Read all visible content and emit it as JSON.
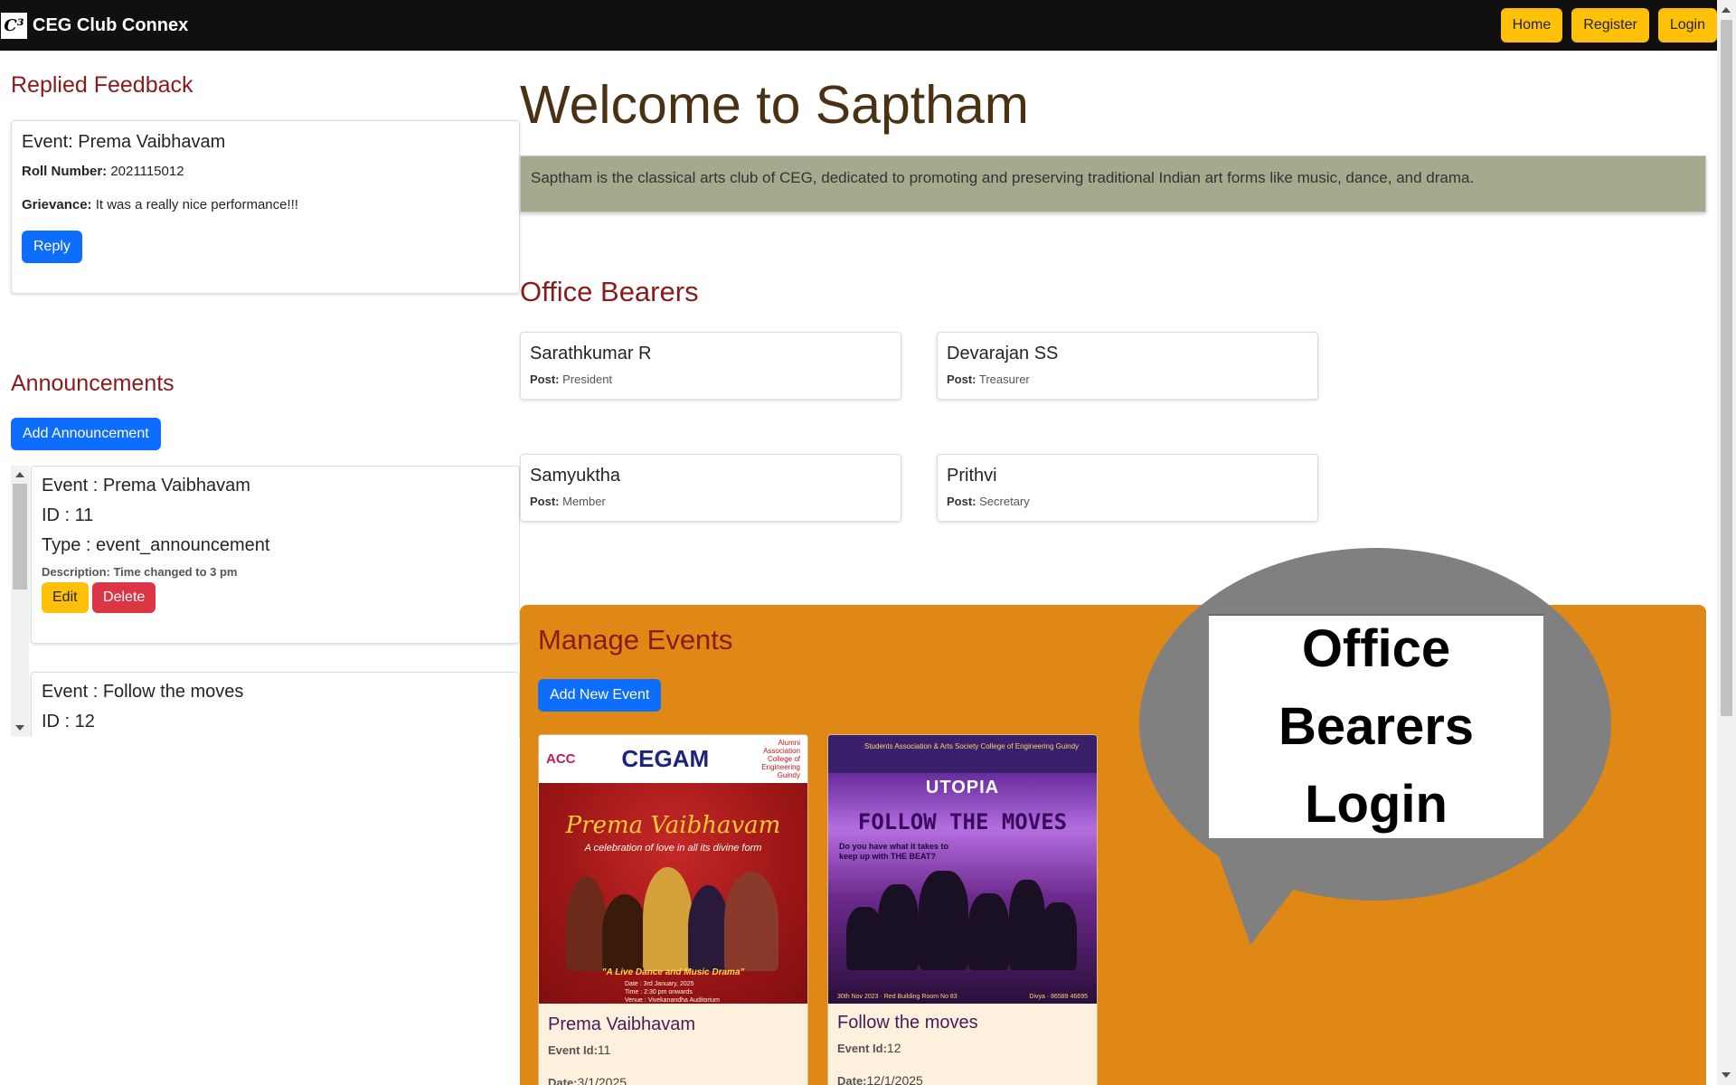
{
  "navbar": {
    "brand_logo": "C³",
    "brand": "CEG Club Connex",
    "buttons": [
      "Home",
      "Register",
      "Login"
    ]
  },
  "feedback": {
    "title": "Replied Feedback",
    "event": "Event: Prema Vaibhavam",
    "roll_label": "Roll Number:",
    "roll_value": "2021115012",
    "grievance_label": "Grievance:",
    "grievance_value": "It was a really nice performance!!!",
    "reply_label": "Reply"
  },
  "announcements": {
    "title": "Announcements",
    "add_label": "Add Announcement",
    "items": [
      {
        "event": "Event : Prema Vaibhavam",
        "id": "ID : 11",
        "type": "Type : event_announcement",
        "description": "Description: Time changed to 3 pm",
        "edit_label": "Edit",
        "delete_label": "Delete"
      },
      {
        "event": "Event : Follow the moves",
        "id": "ID : 12"
      }
    ]
  },
  "club": {
    "welcome": "Welcome to Saptham",
    "about": "Saptham is the classical arts club of CEG, dedicated to promoting and preserving traditional Indian art forms like music, dance, and drama."
  },
  "office_bearers": {
    "title": "Office Bearers",
    "post_label": "Post:",
    "members": [
      {
        "name": "Sarathkumar R",
        "post": "President"
      },
      {
        "name": "Devarajan SS",
        "post": "Treasurer"
      },
      {
        "name": "Samyuktha",
        "post": "Member"
      },
      {
        "name": "Prithvi",
        "post": "Secretary"
      }
    ]
  },
  "events": {
    "title": "Manage Events",
    "add_label": "Add New Event",
    "id_label": "Event Id:",
    "date_label": "Date:",
    "items": [
      {
        "name": "Prema Vaibhavam",
        "id": "11",
        "date": "3/1/2025",
        "poster": {
          "logo_left": "ACC",
          "logo_center": "CEGAM",
          "logo_right": "Alumni Association College of Engineering Guindy",
          "title": "Prema Vaibhavam",
          "subtitle": "A celebration of love in all its divine form",
          "tagline": "\"A Live Dance and Music Drama\"",
          "info": [
            "Date : 3rd January, 2025",
            "Time : 2:30 pm onwards",
            "Venue : Vivekanandha Auditorium"
          ]
        }
      },
      {
        "name": "Follow the moves",
        "id": "12",
        "date": "12/1/2025",
        "poster": {
          "header": "Students Association & Arts Society College of Engineering Guindy",
          "brand": "UTOPIA",
          "title": "FOLLOW THE MOVES",
          "question": "Do you have what it takes to keep up with THE BEAT?",
          "foot_left": "30th Nov 2023 · Red Building Room No 83",
          "foot_right": "Divya · 86589 46695"
        }
      }
    ]
  },
  "overlay": {
    "lines": [
      "Office",
      "Bearers",
      "Login"
    ],
    "color": "#808080"
  }
}
